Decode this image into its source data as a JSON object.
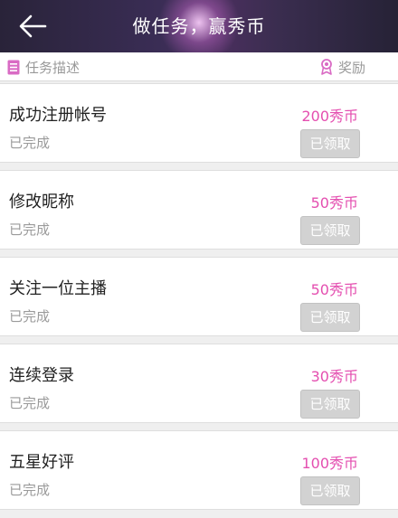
{
  "header": {
    "title": "做任务，赢秀币",
    "back_icon": "arrow-left-icon"
  },
  "subheader": {
    "left_label": "任务描述",
    "left_icon": "list-icon",
    "right_label": "奖励",
    "right_icon": "award-ribbon-icon"
  },
  "colors": {
    "accent": "#e44fb0",
    "header_bg": "#2f2840"
  },
  "tasks": [
    {
      "name": "成功注册帐号",
      "status": "已完成",
      "reward": "200秀币",
      "button": "已领取"
    },
    {
      "name": "修改昵称",
      "status": "已完成",
      "reward": "50秀币",
      "button": "已领取"
    },
    {
      "name": "关注一位主播",
      "status": "已完成",
      "reward": "50秀币",
      "button": "已领取"
    },
    {
      "name": "连续登录",
      "status": "已完成",
      "reward": "30秀币",
      "button": "已领取"
    },
    {
      "name": "五星好评",
      "status": "已完成",
      "reward": "100秀币",
      "button": "已领取"
    }
  ]
}
